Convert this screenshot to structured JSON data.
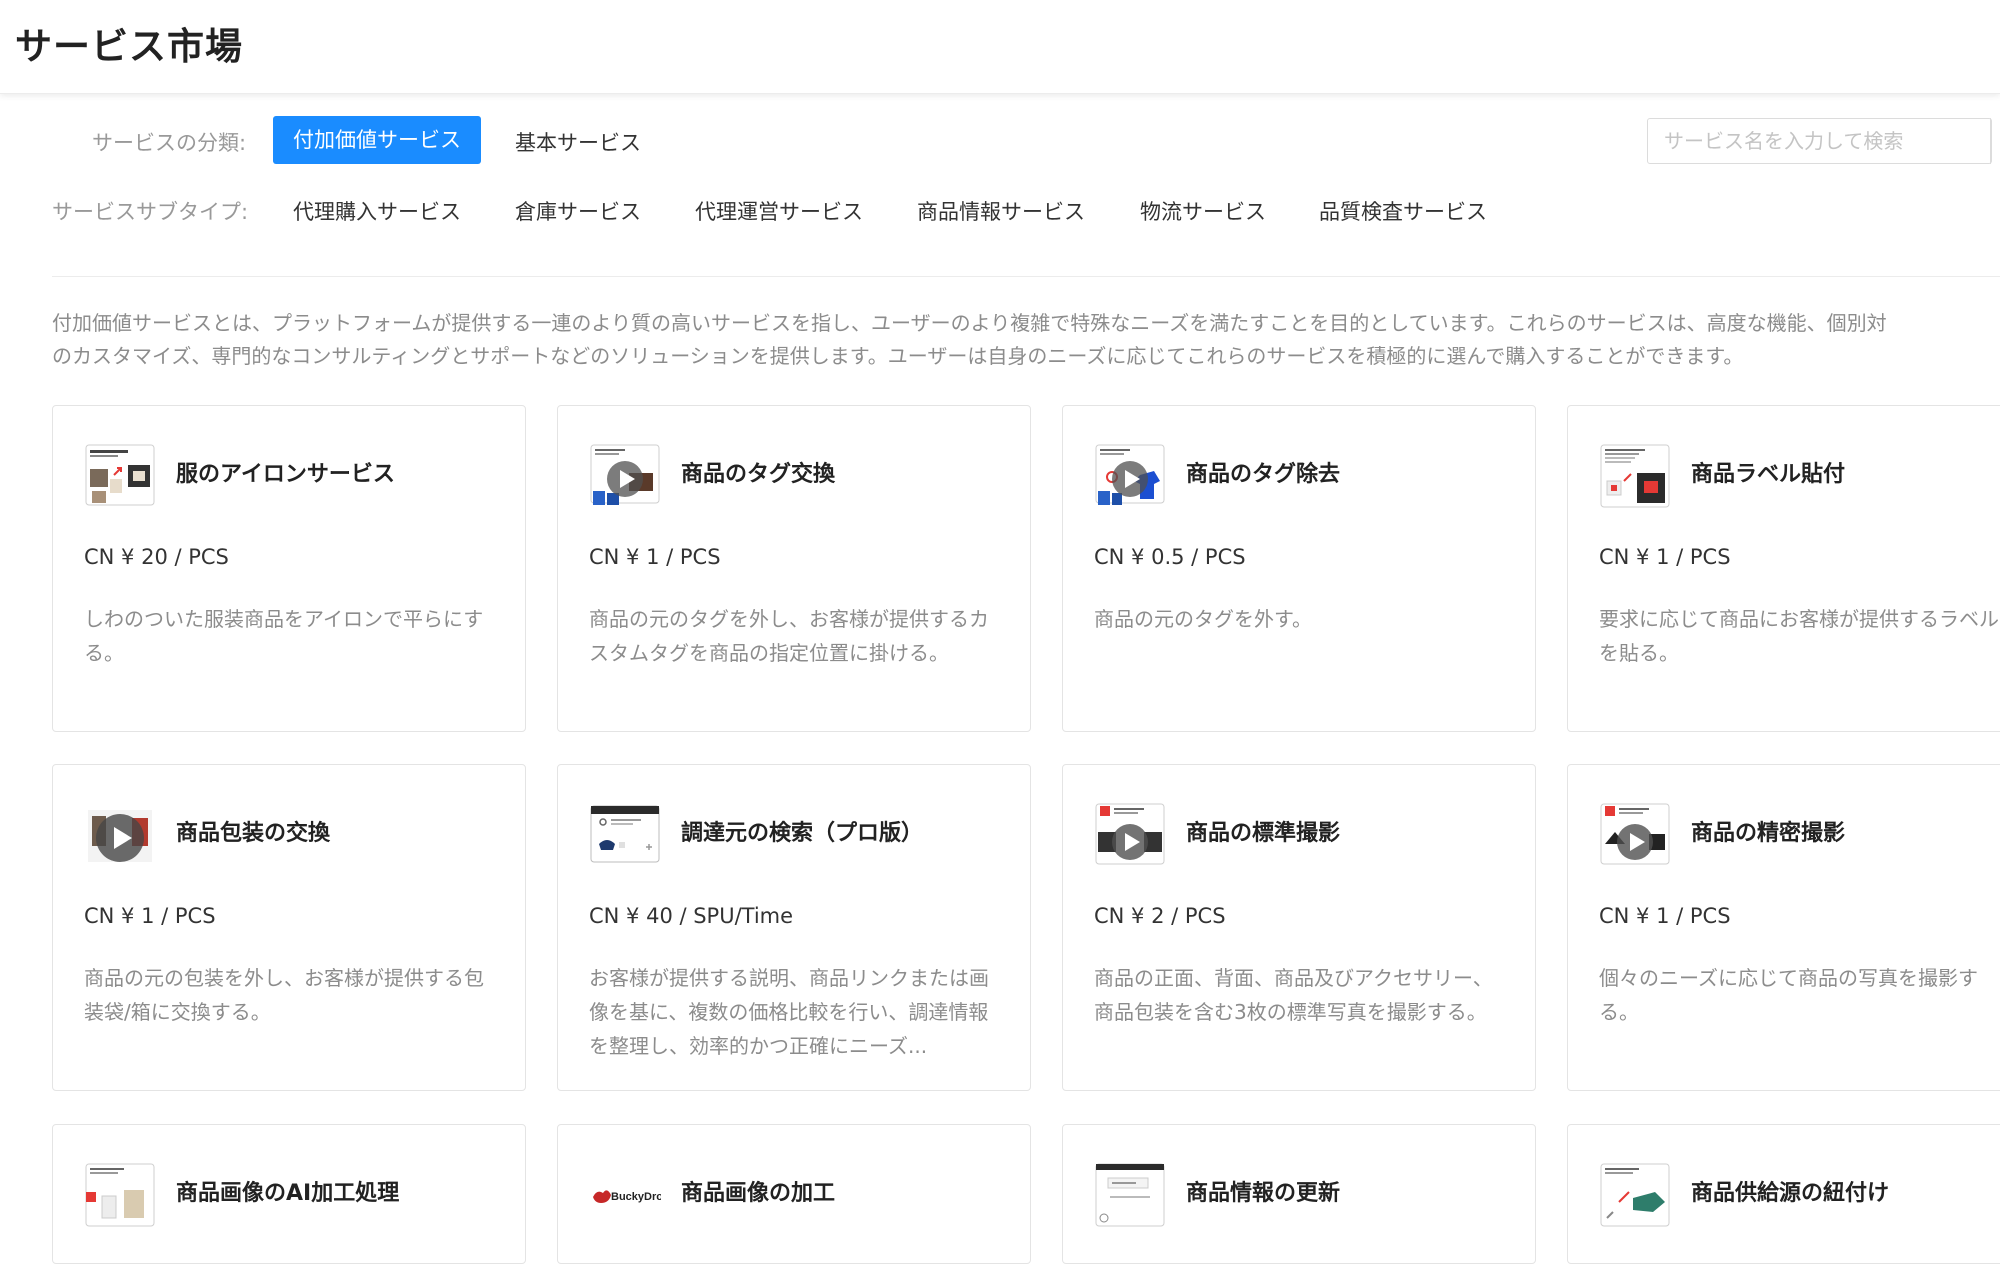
{
  "header": {
    "title": "サービス市場"
  },
  "filters": {
    "category_label": "サービスの分類:",
    "categories": [
      {
        "label": "付加価値サービス",
        "active": true
      },
      {
        "label": "基本サービス",
        "active": false
      }
    ],
    "subtype_label": "サービスサブタイプ:",
    "subtypes": [
      "代理購入サービス",
      "倉庫サービス",
      "代理運営サービス",
      "商品情報サービス",
      "物流サービス",
      "品質検査サービス"
    ]
  },
  "search": {
    "placeholder": "サービス名を入力して検索",
    "value": ""
  },
  "description": {
    "line1": "付加価値サービスとは、プラットフォームが提供する一連のより質の高いサービスを指し、ユーザーのより複雑で特殊なニーズを満たすことを目的としています。これらのサービスは、高度な機能、個別対",
    "line2": "のカスタマイズ、専門的なコンサルティングとサポートなどのソリューションを提供します。ユーザーは自身のニーズに応じてこれらのサービスを積極的に選んで購入することができます。"
  },
  "accent_color": "#1a8cff",
  "cards": [
    {
      "title": "服のアイロンサービス",
      "price": "CN ¥ 20 / PCS",
      "desc": "しわのついた服装商品をアイロンで平らにする。",
      "thumb": "ironing-thumbnail"
    },
    {
      "title": "商品のタグ交換",
      "price": "CN ¥ 1 / PCS",
      "desc": "商品の元のタグを外し、お客様が提供するカスタムタグを商品の指定位置に掛ける。",
      "thumb": "tag-replace-video-thumbnail"
    },
    {
      "title": "商品のタグ除去",
      "price": "CN ¥ 0.5 / PCS",
      "desc": "商品の元のタグを外す。",
      "thumb": "tag-remove-video-thumbnail"
    },
    {
      "title": "商品ラベル貼付",
      "price": "CN ¥ 1 / PCS",
      "desc": "要求に応じて商品にお客様が提供するラベルを貼る。",
      "thumb": "label-thumbnail"
    },
    {
      "title": "商品包装の交換",
      "price": "CN ¥ 1 / PCS",
      "desc": "商品の元の包装を外し、お客様が提供する包装袋/箱に交換する。",
      "thumb": "packaging-video-thumbnail"
    },
    {
      "title": "調達元の検索（プロ版）",
      "price": "CN ¥ 40 / SPU/Time",
      "desc": "お客様が提供する説明、商品リンクまたは画像を基に、複数の価格比較を行い、調達情報を整理し、効率的かつ正確にニーズ...",
      "thumb": "sourcing-thumbnail"
    },
    {
      "title": "商品の標準撮影",
      "price": "CN ¥ 2 / PCS",
      "desc": "商品の正面、背面、商品及びアクセサリー、商品包装を含む3枚の標準写真を撮影する。",
      "thumb": "standard-photo-video-thumbnail"
    },
    {
      "title": "商品の精密撮影",
      "price": "CN ¥ 1 / PCS",
      "desc": "個々のニーズに応じて商品の写真を撮影する。",
      "thumb": "detail-photo-video-thumbnail"
    },
    {
      "title": "商品画像のAI加工処理",
      "price": "",
      "desc": "",
      "thumb": "ai-image-thumbnail"
    },
    {
      "title": "商品画像の加工",
      "price": "",
      "desc": "",
      "thumb": "buckydrop-logo",
      "logo_text": "BuckyDrop"
    },
    {
      "title": "商品情報の更新",
      "price": "",
      "desc": "",
      "thumb": "info-update-thumbnail"
    },
    {
      "title": "商品供給源の紐付け",
      "price": "",
      "desc": "",
      "thumb": "source-link-thumbnail"
    }
  ]
}
